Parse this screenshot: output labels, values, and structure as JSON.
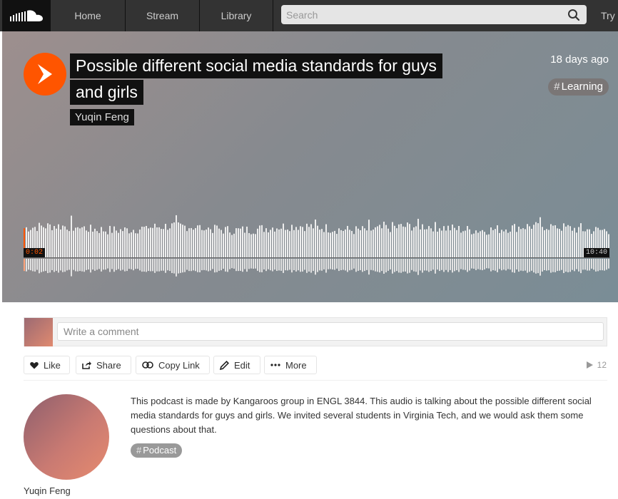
{
  "nav": {
    "home": "Home",
    "stream": "Stream",
    "library": "Library",
    "search_placeholder": "Search",
    "try": "Try"
  },
  "track": {
    "title_line1": "Possible different social media standards for guys",
    "title_line2": "and girls",
    "artist": "Yuqin Feng",
    "posted": "18 days ago",
    "genre_tag": "Learning",
    "current_time": "0:02",
    "duration": "10:40",
    "progress": 0.003
  },
  "comment": {
    "placeholder": "Write a comment"
  },
  "actions": {
    "like": "Like",
    "share": "Share",
    "copy_link": "Copy Link",
    "edit": "Edit",
    "more": "More",
    "play_count": "12"
  },
  "description": {
    "user": "Yuqin Feng",
    "text": "This podcast is made by Kangaroos group in ENGL 3844. This audio is talking about the possible different social media standards for guys and girls. We invited several students in Virginia Tech, and we would ask them some questions about that.",
    "tag": "Podcast"
  },
  "colors": {
    "accent": "#ff5500",
    "nav_bg": "#333333"
  },
  "icons": {
    "logo": "soundcloud-logo-icon",
    "search": "search-icon",
    "play": "play-icon",
    "like": "heart-icon",
    "share": "share-icon",
    "copy": "link-icon",
    "edit": "pencil-icon",
    "more": "ellipsis-icon",
    "plays": "play-count-icon"
  }
}
